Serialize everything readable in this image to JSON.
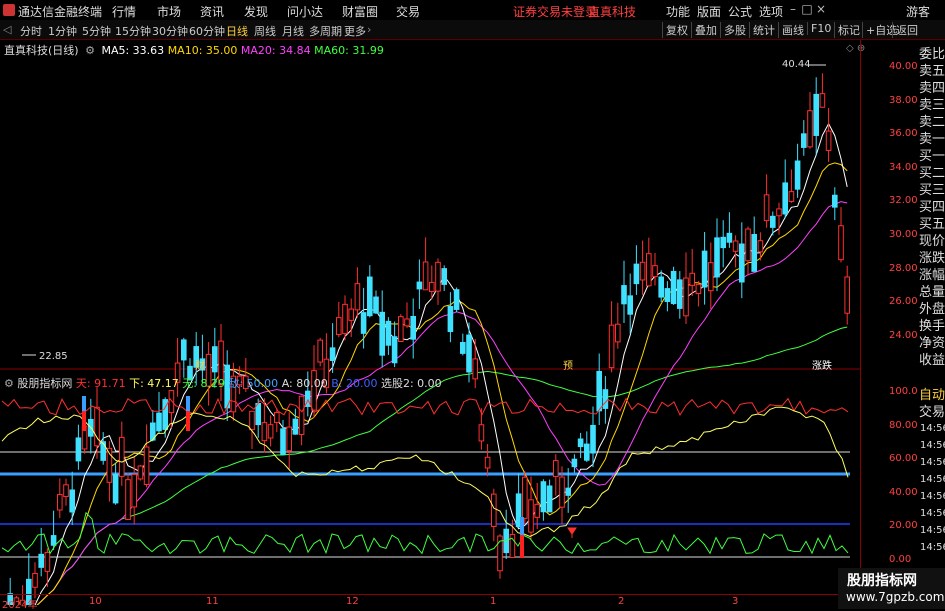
{
  "app": {
    "title": "通达信金融终端"
  },
  "menu": [
    "行情",
    "市场",
    "资讯",
    "发现",
    "问小达",
    "财富圈",
    "交易"
  ],
  "status": {
    "login": "证券交易未登录",
    "stock": "直真科技"
  },
  "right_menu": [
    "功能",
    "版面",
    "公式",
    "选项"
  ],
  "guest": "游客",
  "periods": [
    "分时",
    "1分钟",
    "5分钟",
    "15分钟",
    "30分钟",
    "60分钟",
    "日线",
    "周线",
    "月线",
    "多周期",
    "更多"
  ],
  "active_period": "日线",
  "toolbar_right": [
    "复权",
    "叠加",
    "多股",
    "统计",
    "画线",
    "F10",
    "标记",
    "+自选",
    "返回"
  ],
  "main_chart": {
    "name": "直真科技(日线)",
    "ma": [
      {
        "label": "MA5: 33.63",
        "color": "#ffffff"
      },
      {
        "label": "MA10: 35.00",
        "color": "#ffd800"
      },
      {
        "label": "MA20: 34.84",
        "color": "#ff40ff"
      },
      {
        "label": "MA60: 31.99",
        "color": "#40ff40"
      }
    ],
    "price_high": "40.44",
    "price_low": "22.85",
    "markers": {
      "m1": "财",
      "m2": "预",
      "m3": "涨跌"
    },
    "y_ticks": [
      "40.00",
      "38.00",
      "36.00",
      "34.00",
      "32.00",
      "30.00",
      "28.00",
      "26.00",
      "24.00"
    ]
  },
  "indicator": {
    "name": "股朋指标网",
    "items": [
      {
        "label": "天: 91.71",
        "color": "#ff3030"
      },
      {
        "label": "下: 47.17",
        "color": "#ffff60"
      },
      {
        "label": "无: 8.29",
        "color": "#40ff40"
      },
      {
        "label": "敌: 50.00",
        "color": "#40a0ff"
      },
      {
        "label": "A: 80.00",
        "color": "#dddddd"
      },
      {
        "label": "B: 20.00",
        "color": "#4060ff"
      },
      {
        "label": "选股2: 0.00",
        "color": "#dddddd"
      }
    ],
    "y_ticks": [
      "100.0",
      "80.00",
      "60.00",
      "40.00",
      "20.00",
      "0.00"
    ],
    "side_times": [
      "14:56",
      "14:56",
      "14:56",
      "14:56",
      "14:56",
      "14:56",
      "14:56",
      "14:56"
    ]
  },
  "side_panel": [
    "委比",
    "卖五",
    "卖四",
    "卖三",
    "卖二",
    "卖一",
    "买一",
    "买二",
    "买三",
    "买四",
    "买五",
    "现价",
    "涨跌",
    "涨幅",
    "总量",
    "外盘",
    "换手",
    "净资",
    "收益"
  ],
  "side_extra": [
    "自动",
    "交易"
  ],
  "time_axis": [
    "2024年",
    "10",
    "11",
    "12",
    "1",
    "2",
    "3"
  ],
  "watermark": {
    "line1": "股朋指标网",
    "line2": "www.7gpzb.com"
  }
}
